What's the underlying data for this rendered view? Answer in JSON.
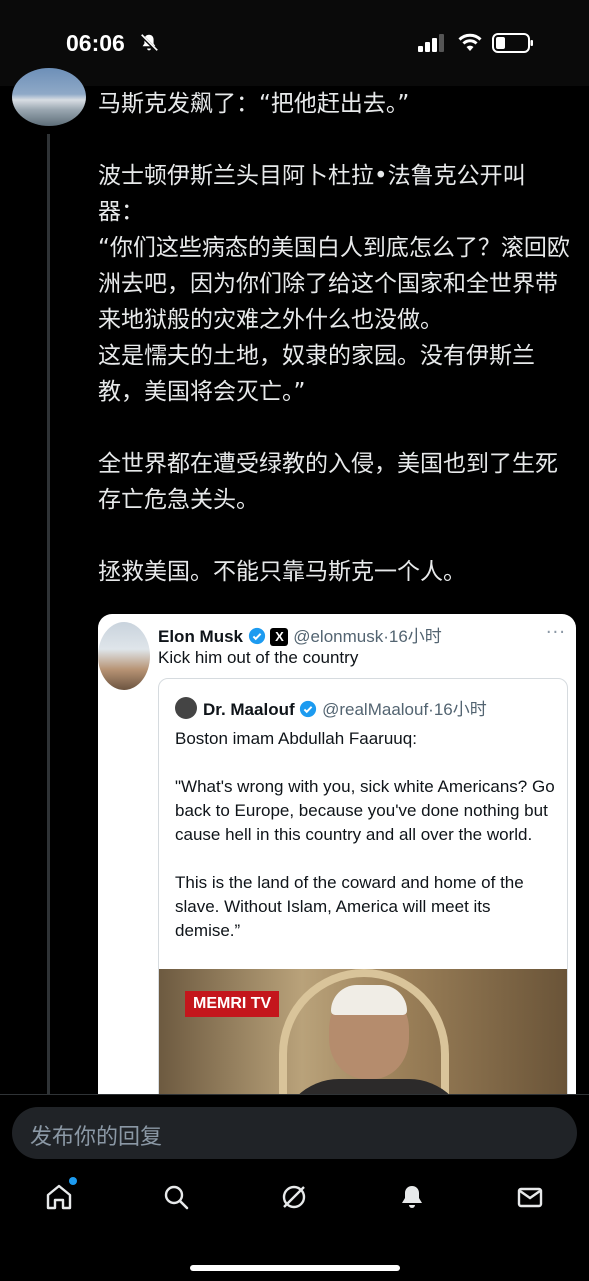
{
  "status_bar": {
    "time": "06:06"
  },
  "post": {
    "paragraphs": [
      "马斯克发飙了：“把他赶出去。”",
      "波士顿伊斯兰头目阿卜杜拉•法鲁克公开叫器：",
      "“你们这些病态的美国白人到底怎么了？滚回欧洲去吧，因为你们除了给这个国家和全世界带来地狱般的灾难之外什么也没做。",
      "这是懦夫的土地，奴隶的家园。没有伊斯兰教，美国将会灭亡。”",
      "全世界都在遭受绿教的入侵，美国也到了生死存亡危急关头。",
      "拯救美国。不能只靠马斯克一个人。"
    ]
  },
  "quoted_post": {
    "author": "Elon Musk",
    "x_badge": "X",
    "handle_time": "@elonmusk·16小时",
    "more": "···",
    "text": "Kick him out of the country",
    "inner": {
      "author": "Dr. Maalouf",
      "handle_time": "@realMaalouf·16小时",
      "body": [
        "Boston imam Abdullah Faaruuq:",
        "\"What's wrong with you, sick white Americans? Go back to Europe, because you've done nothing but cause hell in this country and all over the world.",
        "This is the land of the coward and home of the slave. Without Islam, America will meet its demise.”"
      ],
      "video_logo": "MEMRI TV"
    }
  },
  "reply": {
    "placeholder": "发布你的回复"
  },
  "tabs": [
    {
      "icon": "home-icon"
    },
    {
      "icon": "search-icon"
    },
    {
      "icon": "grok-icon"
    },
    {
      "icon": "notifications-icon"
    },
    {
      "icon": "messages-icon"
    }
  ],
  "colors": {
    "accent": "#1d9bf0",
    "background": "#000000",
    "text": "#e7e9ea"
  }
}
